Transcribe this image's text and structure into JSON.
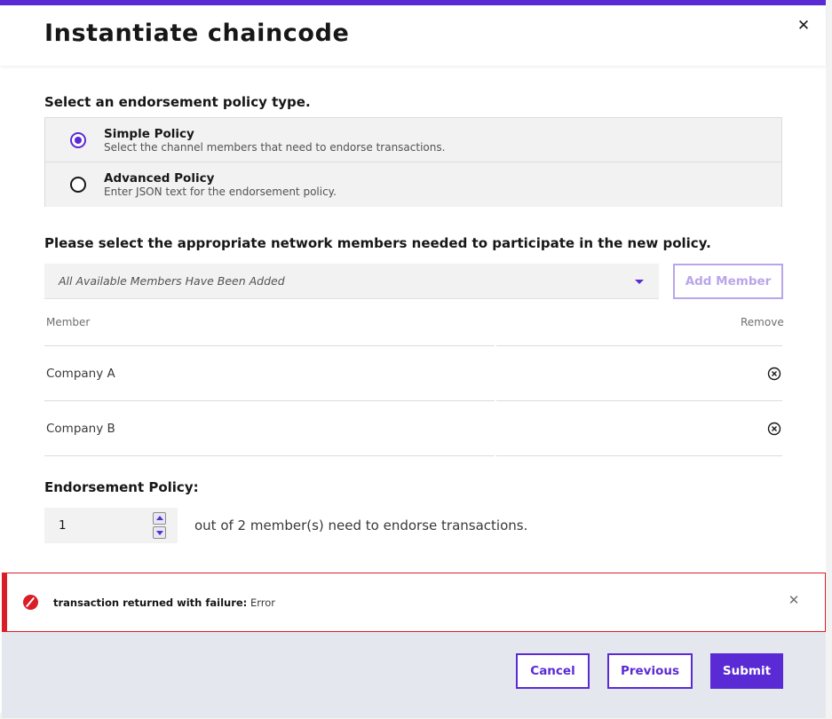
{
  "modal": {
    "title": "Instantiate chaincode",
    "close_icon": "close-icon"
  },
  "policy_type": {
    "heading": "Select an endorsement policy type.",
    "options": [
      {
        "title": "Simple Policy",
        "description": "Select the channel members that need to endorse transactions.",
        "selected": true
      },
      {
        "title": "Advanced Policy",
        "description": "Enter JSON text for the endorsement policy.",
        "selected": false
      }
    ]
  },
  "members": {
    "heading": "Please select the appropriate network members needed to participate in the new policy.",
    "dropdown_value": "All Available Members Have Been Added",
    "add_button": "Add Member",
    "columns": {
      "member": "Member",
      "remove": "Remove"
    },
    "rows": [
      {
        "name": "Company A",
        "remove_icon": "remove-circle-icon"
      },
      {
        "name": "Company B",
        "remove_icon": "remove-circle-icon"
      }
    ]
  },
  "endorsement": {
    "heading": "Endorsement Policy:",
    "value": "1",
    "suffix": "out of 2 member(s) need to endorse transactions."
  },
  "error": {
    "label": "transaction returned with failure:",
    "message": "Error",
    "color": "#da1e28"
  },
  "footer": {
    "cancel": "Cancel",
    "previous": "Previous",
    "submit": "Submit"
  },
  "colors": {
    "accent": "#5a2bd4",
    "error": "#da1e28",
    "footer_bg": "#e4e8ee"
  }
}
